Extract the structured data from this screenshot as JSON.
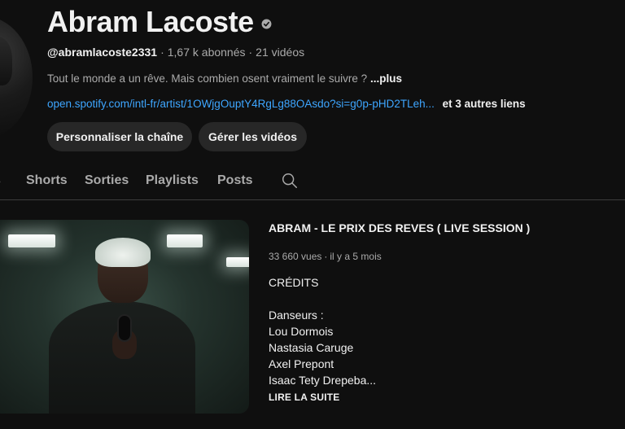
{
  "channel": {
    "name": "Abram Lacoste",
    "handle": "@abramlacoste2331",
    "subscribers": "1,67 k abonnés",
    "video_count": "21 vidéos",
    "description": "Tout le monde a un rêve. Mais combien osent vraiment le suivre ?",
    "more_label": "...plus",
    "link_url": "open.spotify.com/intl-fr/artist/1OWjgOuptY4RgLg88OAsdo?si=g0p-pHD2TLeh...",
    "other_links": "et 3 autres liens",
    "verified_icon": "verified-badge-icon"
  },
  "actions": {
    "customize_label": "Personnaliser la chaîne",
    "manage_label": "Gérer les vidéos"
  },
  "tabs": {
    "prev_partial": "s",
    "items": [
      {
        "label": "Shorts"
      },
      {
        "label": "Sorties"
      },
      {
        "label": "Playlists"
      },
      {
        "label": "Posts"
      }
    ],
    "search_icon": "search-icon"
  },
  "featured": {
    "title": "ABRAM  - LE PRIX DES REVES  ( LIVE SESSION )",
    "views": "33 660 vues",
    "age": "il y a 5 mois",
    "description_lines": [
      "CRÉDITS",
      "",
      "Danseurs :",
      "Lou Dormois",
      "Nastasia Caruge",
      "Axel Prepont",
      "Isaac Tety Drepeba..."
    ],
    "read_more": "LIRE LA SUITE"
  },
  "colors": {
    "background": "#0f0f0f",
    "link": "#3ea6ff",
    "button_bg": "#272727",
    "muted_text": "#aaaaaa"
  }
}
